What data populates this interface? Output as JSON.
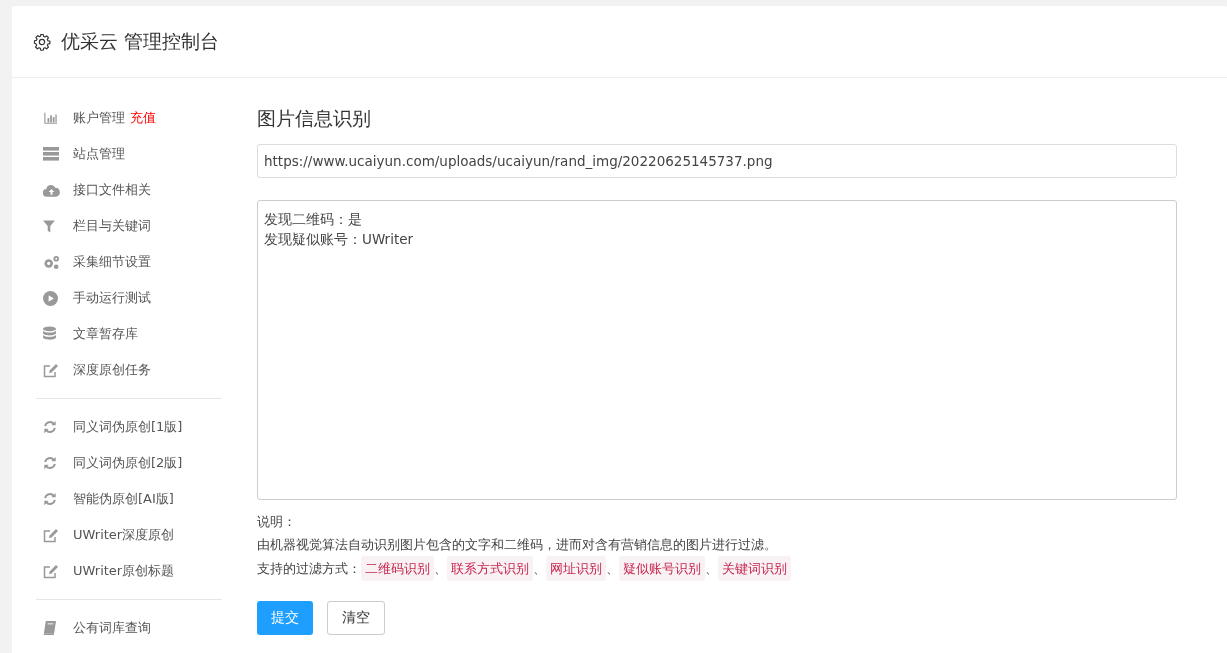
{
  "header": {
    "title": "优采云 管理控制台"
  },
  "sidebar": {
    "groups": [
      {
        "items": [
          {
            "label": "账户管理",
            "badge": "充值"
          },
          {
            "label": "站点管理"
          },
          {
            "label": "接口文件相关"
          },
          {
            "label": "栏目与关键词"
          },
          {
            "label": "采集细节设置"
          },
          {
            "label": "手动运行测试"
          },
          {
            "label": "文章暂存库"
          },
          {
            "label": "深度原创任务"
          }
        ]
      },
      {
        "items": [
          {
            "label": "同义词伪原创[1版]"
          },
          {
            "label": "同义词伪原创[2版]"
          },
          {
            "label": "智能伪原创[AI版]"
          },
          {
            "label": "UWriter深度原创"
          },
          {
            "label": "UWriter原创标题"
          }
        ]
      },
      {
        "items": [
          {
            "label": "公有词库查询"
          }
        ]
      }
    ]
  },
  "main": {
    "title": "图片信息识别",
    "url_field": {
      "value": "https://www.ucaiyun.com/uploads/ucaiyun/rand_img/20220625145737.png"
    },
    "result_box": {
      "lines": [
        "发现二维码：是",
        "发现疑似账号：UWriter"
      ]
    },
    "note_label": "说明：",
    "note_text": "由机器视觉算法自动识别图片包含的文字和二维码，进而对含有营销信息的图片进行过滤。",
    "filters_label": "支持的过滤方式：",
    "filter_separator": "、",
    "filters": [
      "二维码识别",
      "联系方式识别",
      "网址识别",
      "疑似账号识别",
      "关键词识别"
    ],
    "buttons": [
      {
        "label": "提交",
        "kind": "primary"
      },
      {
        "label": "清空",
        "kind": "default"
      }
    ]
  }
}
